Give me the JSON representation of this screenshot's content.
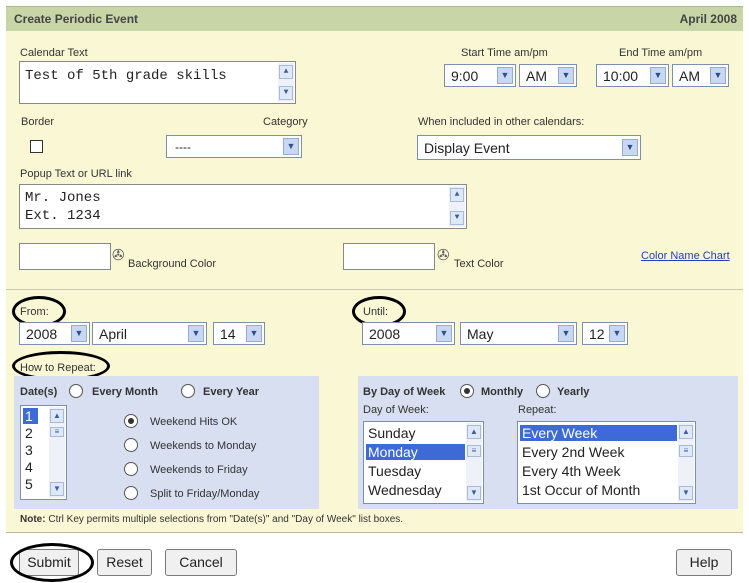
{
  "title": "Create Periodic Event",
  "month_label": "April 2008",
  "calendar_text": {
    "label": "Calendar Text",
    "value": "Test of 5th grade skills"
  },
  "start_time": {
    "label": "Start Time am/pm",
    "hour": "9:00",
    "ampm": "AM"
  },
  "end_time": {
    "label": "End Time am/pm",
    "hour": "10:00",
    "ampm": "AM"
  },
  "border": {
    "label": "Border",
    "checked": false
  },
  "category": {
    "label": "Category",
    "value": "----"
  },
  "other_calendars": {
    "label": "When included in other calendars:",
    "value": "Display Event"
  },
  "popup": {
    "label": "Popup Text or URL link",
    "line1": "Mr. Jones",
    "line2": "Ext. 1234"
  },
  "background_color": {
    "label": "Background Color"
  },
  "text_color": {
    "label": "Text Color"
  },
  "color_chart_link": "Color Name Chart",
  "from": {
    "label": "From:",
    "year": "2008",
    "month": "April",
    "day": "14"
  },
  "until": {
    "label": "Until:",
    "year": "2008",
    "month": "May",
    "day": "12"
  },
  "how_to_repeat": "How to Repeat:",
  "dates": {
    "label": "Date(s)",
    "every_month": "Every Month",
    "every_year": "Every Year",
    "items": [
      "1",
      "2",
      "3",
      "4",
      "5"
    ],
    "options": [
      "Weekend Hits OK",
      "Weekends to Monday",
      "Weekends to Friday",
      "Split to Friday/Monday"
    ]
  },
  "by_day": {
    "label": "By Day of Week",
    "monthly": "Monthly",
    "yearly": "Yearly",
    "day_label": "Day of Week:",
    "days": [
      "Sunday",
      "Monday",
      "Tuesday",
      "Wednesday"
    ],
    "repeat_label": "Repeat:",
    "repeats": [
      "Every Week",
      "Every 2nd Week",
      "Every 4th Week",
      "1st Occur of Month"
    ]
  },
  "note_bold": "Note:",
  "note_text": "Ctrl Key permits multiple selections from \"Date(s)\" and \"Day of Week\" list boxes.",
  "buttons": {
    "submit": "Submit",
    "reset": "Reset",
    "cancel": "Cancel",
    "help": "Help"
  }
}
